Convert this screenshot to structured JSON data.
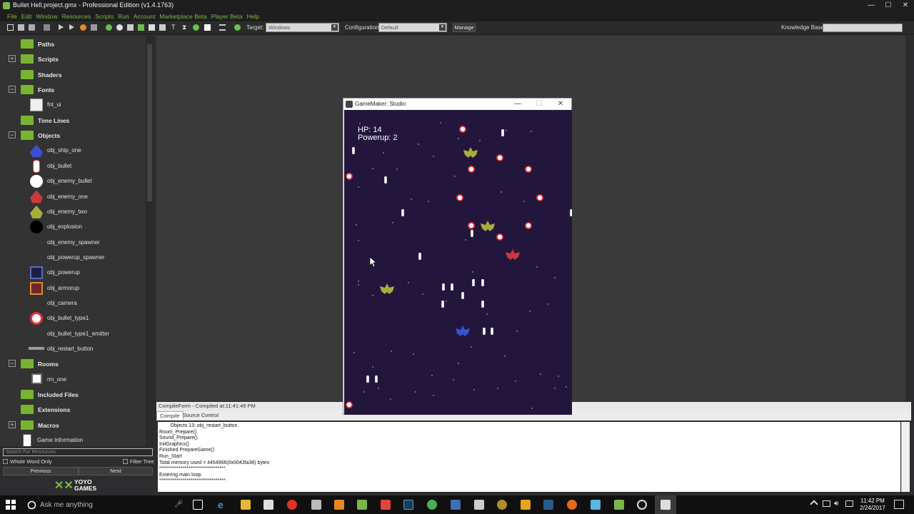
{
  "window": {
    "title": "Bullet Hell.project.gmx  -  Professional Edition (v1.4.1763)",
    "controls": [
      "—",
      "☐",
      "✕"
    ]
  },
  "menu": [
    "File",
    "Edit",
    "Window",
    "Resources",
    "Scripts",
    "Run",
    "Account",
    "Marketplace Beta",
    "Player Beta",
    "Help"
  ],
  "toolbar": {
    "target_label": "Target:",
    "target_value": "Windows",
    "config_label": "Configuration:",
    "config_value": "Default",
    "manage": "Manage",
    "kb_label": "Knowledge Base:"
  },
  "tree": [
    {
      "type": "folder",
      "label": "Paths",
      "expander": ""
    },
    {
      "type": "folder",
      "label": "Scripts",
      "expander": "+"
    },
    {
      "type": "folder",
      "label": "Shaders",
      "expander": ""
    },
    {
      "type": "folder",
      "label": "Fonts",
      "expander": "−"
    },
    {
      "type": "item",
      "label": "fnt_ui",
      "icon": "font"
    },
    {
      "type": "folder",
      "label": "Time Lines",
      "expander": ""
    },
    {
      "type": "folder",
      "label": "Objects",
      "expander": "−"
    },
    {
      "type": "item",
      "label": "obj_ship_one",
      "icon": "ship-blue"
    },
    {
      "type": "item",
      "label": "obj_bullet",
      "icon": "bullet"
    },
    {
      "type": "item",
      "label": "obj_enemy_bullet",
      "icon": "circle-white"
    },
    {
      "type": "item",
      "label": "obj_enemy_one",
      "icon": "ship-red"
    },
    {
      "type": "item",
      "label": "obj_enemy_two",
      "icon": "ship-yellow"
    },
    {
      "type": "item",
      "label": "obj_explosion",
      "icon": "circle-black"
    },
    {
      "type": "item",
      "label": "obj_enemy_spawner",
      "icon": "none"
    },
    {
      "type": "item",
      "label": "obj_powerup_spawner",
      "icon": "none"
    },
    {
      "type": "item",
      "label": "obj_powerup",
      "icon": "box-blue"
    },
    {
      "type": "item",
      "label": "obj_armorup",
      "icon": "box-orange"
    },
    {
      "type": "item",
      "label": "obj_camera",
      "icon": "none"
    },
    {
      "type": "item",
      "label": "obj_bullet_type1",
      "icon": "circle-red"
    },
    {
      "type": "item",
      "label": "obj_bullet_type1_emitter",
      "icon": "none"
    },
    {
      "type": "item",
      "label": "obj_restart_button",
      "icon": "bar"
    },
    {
      "type": "folder",
      "label": "Rooms",
      "expander": "−"
    },
    {
      "type": "item",
      "label": "rm_one",
      "icon": "room"
    },
    {
      "type": "folder",
      "label": "Included Files",
      "expander": ""
    },
    {
      "type": "folder",
      "label": "Extensions",
      "expander": ""
    },
    {
      "type": "folder",
      "label": "Macros",
      "expander": "+"
    },
    {
      "type": "info",
      "label": "Game Information",
      "icon": "info"
    }
  ],
  "search": {
    "placeholder": "Search For Resources",
    "whole_word": "Whole Word Only",
    "filter_tree": "Filter Tree",
    "previous": "Previous",
    "next": "Next"
  },
  "logo": {
    "brand": "YOYO",
    "sub": "GAMES"
  },
  "compile": {
    "header": "CompileForm - Compiled at:11:41:49 PM",
    "tabs": [
      "Compile",
      "Source Control"
    ],
    "lines": [
      "        Objects 13: obj_restart_button",
      "Room_Prepare()",
      "Sound_Prepare()",
      "InitGraphics()",
      "Finished PrepareGame()",
      "Run_Start",
      "Total memory used = 4454966(0x0043fa36) bytes",
      "**********************************.",
      "Entering main loop.",
      "**********************************."
    ]
  },
  "game": {
    "title": "GameMaker: Studio",
    "hp": "HP: 14",
    "powerup": "Powerup: 2"
  },
  "taskbar": {
    "search_text": "Ask me anything",
    "time": "11:42 PM",
    "date": "2/24/2017"
  },
  "colors": {
    "folder": "#78b430",
    "menu": "#7fb54a",
    "game_bg": "#23163d"
  }
}
